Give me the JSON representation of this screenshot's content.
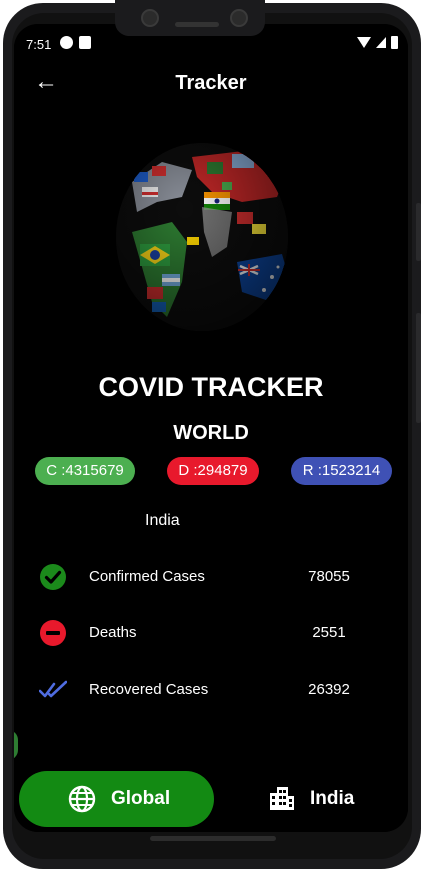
{
  "status_bar": {
    "time": "7:51"
  },
  "app_bar": {
    "title": "Tracker"
  },
  "heading": "COVID TRACKER",
  "subheading": "WORLD",
  "world_stats": {
    "confirmed": "C :4315679",
    "deaths": "D :294879",
    "recovered": "R :1523214"
  },
  "country": {
    "name": "India",
    "rows": [
      {
        "label": "Confirmed Cases",
        "value": "78055",
        "icon": "check-circle-icon"
      },
      {
        "label": "Deaths",
        "value": "2551",
        "icon": "minus-circle-icon"
      },
      {
        "label": "Recovered Cases",
        "value": "26392",
        "icon": "double-check-icon"
      }
    ]
  },
  "bottom_nav": {
    "global_label": "Global",
    "india_label": "India",
    "global_icon": "globe-icon",
    "india_icon": "building-icon"
  },
  "colors": {
    "confirmed": "#4caf50",
    "deaths": "#e8192c",
    "recovered": "#3f51b5",
    "nav_active": "#138a13"
  }
}
